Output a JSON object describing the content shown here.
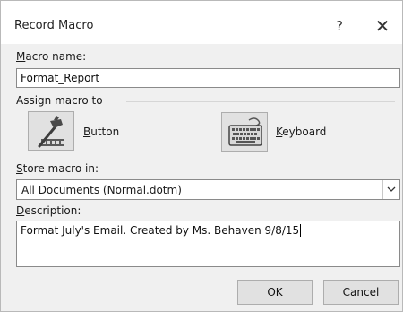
{
  "window": {
    "title": "Record Macro",
    "help_label": "?",
    "close_label": "✕"
  },
  "macro_name": {
    "label_access_key": "M",
    "label_rest": "acro name:",
    "value": "Format_Report"
  },
  "assign": {
    "heading": "Assign macro to",
    "button": {
      "access_key": "B",
      "rest": "utton",
      "icon": "hammer-toolbar-icon"
    },
    "keyboard": {
      "access_key": "K",
      "rest": "eyboard",
      "icon": "keyboard-icon"
    }
  },
  "store": {
    "label_access_key": "S",
    "label_rest": "tore macro in:",
    "value": "All Documents (Normal.dotm)"
  },
  "description": {
    "label_access_key": "D",
    "label_rest": "escription:",
    "value": "Format July's Email. Created by Ms. Behaven 9/8/15"
  },
  "footer": {
    "ok_label": "OK",
    "cancel_label": "Cancel"
  },
  "colors": {
    "dialog_bg": "#f0f0f0",
    "button_bg": "#e1e1e1",
    "border": "#adadad"
  }
}
